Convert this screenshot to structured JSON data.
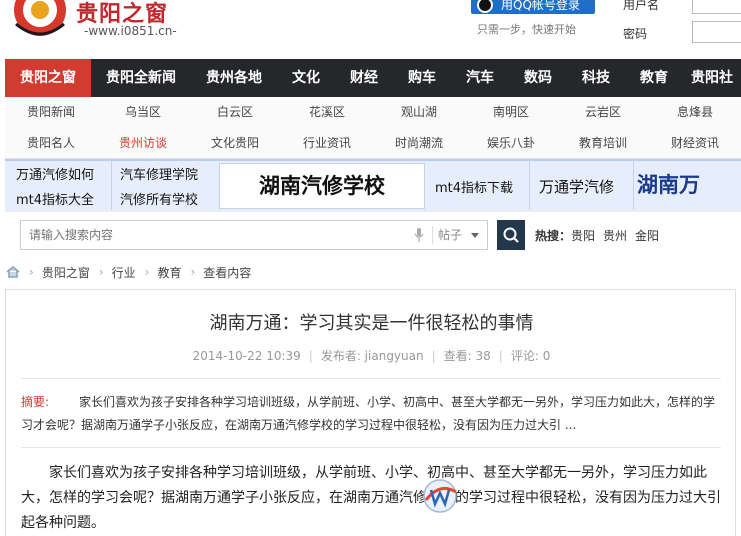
{
  "header": {
    "logo_title": "贵阳之窗",
    "logo_url": "-www.i0851.cn-",
    "qq_login_label": "用QQ帐号登录",
    "qq_note": "只需一步，快速开始",
    "username_label": "用户名",
    "password_label": "密码"
  },
  "main_nav": [
    {
      "label": "贵阳之窗",
      "active": true
    },
    {
      "label": "贵阳全新闻"
    },
    {
      "label": "贵州各地"
    },
    {
      "label": "文化"
    },
    {
      "label": "财经"
    },
    {
      "label": "购车"
    },
    {
      "label": "汽车"
    },
    {
      "label": "数码"
    },
    {
      "label": "科技"
    },
    {
      "label": "教育"
    },
    {
      "label": "贵阳社"
    }
  ],
  "sub_nav": {
    "row1": [
      "贵阳新闻",
      "乌当区",
      "白云区",
      "花溪区",
      "观山湖",
      "南明区",
      "云岩区",
      "息烽县"
    ],
    "row2": [
      "贵阳名人",
      "贵州访谈",
      "文化贵阳",
      "行业资讯",
      "时尚潮流",
      "娱乐八卦",
      "教育培训",
      "财经资讯"
    ],
    "hot_index": 1
  },
  "ads": {
    "col1": [
      "万通汽修如何",
      "mt4指标大全"
    ],
    "col2": [
      "汽车修理学院",
      "汽修所有学校"
    ],
    "box": "湖南汽修学校",
    "mid1": "mt4指标下载",
    "mid2": "万通学汽修",
    "big": "湖南万"
  },
  "search": {
    "placeholder": "请输入搜索内容",
    "scope": "帖子",
    "hot_label": "热搜：",
    "hot_links": [
      "贵阳",
      "贵州",
      "金阳"
    ]
  },
  "breadcrumb": [
    "贵阳之窗",
    "行业",
    "教育",
    "查看内容"
  ],
  "article": {
    "title": "湖南万通：学习其实是一件很轻松的事情",
    "date": "2014-10-22 10:39",
    "author_label": "发布者: jiangyuan",
    "views_label": "查看: 38",
    "comments_label": "评论: 0",
    "summary_tag": "摘要:",
    "summary": "家长们喜欢为孩子安排各种学习培训班级，从学前班、小学、初高中、甚至大学都无一另外，学习压力如此大，怎样的学习才会呢？据湖南万通学子小张反应，在湖南万通汽修学校的学习过程中很轻松，没有因为压力过大引 ...",
    "body": "家长们喜欢为孩子安排各种学习培训班级，从学前班、小学、初高中、甚至大学都无一另外，学习压力如此大，怎样的学习会呢？据湖南万通学子小张反应，在湖南万通汽修学校的学习过程中很轻松，没有因为压力过大引起各种问题。"
  },
  "colors": {
    "brand_red": "#d23b2f",
    "nav_dark": "#26272b",
    "qq_blue": "#1f6fc6",
    "search_btn": "#23374d"
  }
}
